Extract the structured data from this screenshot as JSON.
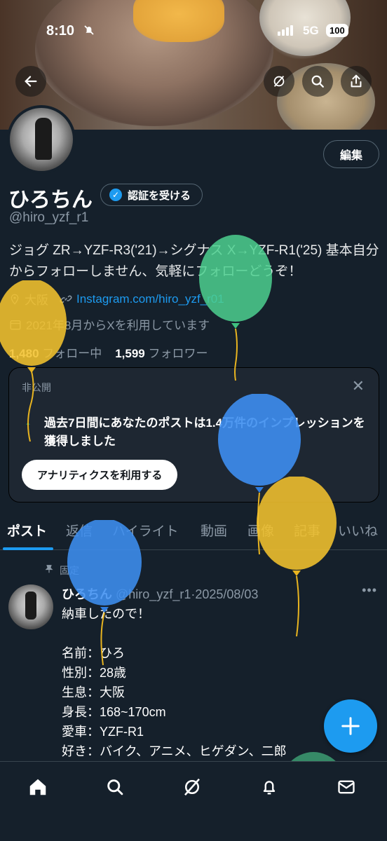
{
  "status_bar": {
    "time": "8:10",
    "network": "5G",
    "battery": "100"
  },
  "profile": {
    "name": "ひろちん",
    "verify_label": "認証を受ける",
    "handle": "@hiro_yzf_r1",
    "edit_label": "編集",
    "bio": "ジョグ ZR→YZF-R3('21)→シグナス X→YZF-R1('25) 基本自分からフォローしません、気軽にフォローどうぞ！",
    "location": "大阪",
    "link": "Instagram.com/hiro_yzf_r01",
    "joined": "2021年8月からXを利用しています",
    "following_count": "1,480",
    "following_label": "フォロー中",
    "followers_count": "1,599",
    "followers_label": "フォロワー"
  },
  "insight_card": {
    "private_label": "非公開",
    "message": "過去7日間にあなたのポストは1.4万件のインプレッションを獲得しました",
    "button_label": "アナリティクスを利用する"
  },
  "tabs": [
    {
      "label": "ポスト",
      "active": true
    },
    {
      "label": "返信"
    },
    {
      "label": "ハイライト"
    },
    {
      "label": "動画"
    },
    {
      "label": "画像"
    },
    {
      "label": "記事"
    },
    {
      "label": "いいね"
    }
  ],
  "pinned_post": {
    "pinned_label": "固定",
    "author": "ひろちん",
    "handle_date": "@hiro_yzf_r1·2025/08/03",
    "lines": [
      "納車したので！",
      "",
      "名前：ひろ",
      "性別：28歳",
      "生息：大阪",
      "身長：168~170cm",
      "愛車：YZF-R1",
      "好き：バイク、アニメ、ヒゲダン、二郎"
    ]
  },
  "colors": {
    "background": "#15202b",
    "accent": "#1d9bf0",
    "balloon_yellow": "#f2c12e",
    "balloon_green": "#4cd08f",
    "balloon_blue": "#3d8ef0"
  },
  "icons": {
    "back": "arrow-left-icon",
    "grok": "grok-icon",
    "search": "search-icon",
    "share": "share-icon",
    "home": "home-icon",
    "explore": "search-icon",
    "communities": "grok-icon",
    "notifications": "bell-icon",
    "messages": "mail-icon"
  }
}
